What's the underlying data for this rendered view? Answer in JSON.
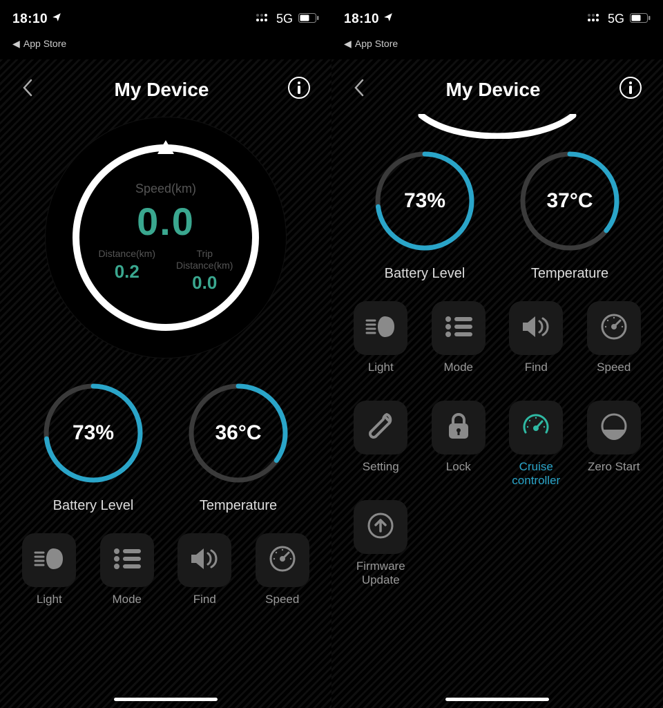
{
  "status": {
    "time": "18:10",
    "network": "5G",
    "back_app": "App Store"
  },
  "nav": {
    "title": "My Device"
  },
  "speedometer": {
    "speed_label": "Speed(km)",
    "speed_value": "0.0",
    "distance_label": "Distance(km)",
    "distance_value": "0.2",
    "trip_label_l1": "Trip",
    "trip_label_l2": "Distance(km)",
    "trip_value": "0.0"
  },
  "left_gauges": {
    "battery_value": "73%",
    "battery_label": "Battery Level",
    "battery_pct": 73,
    "temperature_value": "36°C",
    "temperature_label": "Temperature",
    "temperature_pct": 35
  },
  "right_gauges": {
    "battery_value": "73%",
    "battery_label": "Battery Level",
    "battery_pct": 73,
    "temperature_value": "37°C",
    "temperature_label": "Temperature",
    "temperature_pct": 36
  },
  "buttons_left": {
    "light": "Light",
    "mode": "Mode",
    "find": "Find",
    "speed": "Speed"
  },
  "buttons_right": {
    "light": "Light",
    "mode": "Mode",
    "find": "Find",
    "speed": "Speed",
    "setting": "Setting",
    "lock": "Lock",
    "cruise": "Cruise\ncontroller",
    "zero": "Zero Start",
    "firmware": "Firmware\nUpdate"
  },
  "colors": {
    "accent_teal": "#3aa78f",
    "accent_blue": "#2aa5c9",
    "ring": "#3a3a3a"
  }
}
